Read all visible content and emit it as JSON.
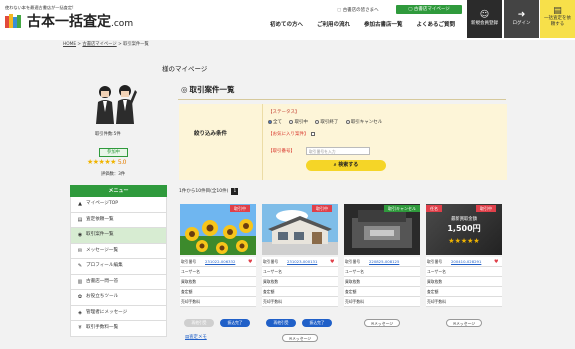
{
  "header": {
    "tagline": "使わない本を最適古書店が一括査定!",
    "logo_main": "古本一括査定",
    "logo_suffix": ".com",
    "greeting": "古書店の皆さまへ",
    "mypage_label": "古書店マイページ",
    "nav": [
      "初めての方へ",
      "ご利用の流れ",
      "参加古書店一覧",
      "よくあるご質問"
    ],
    "btn_register": "新規会員登録",
    "btn_login": "ログイン",
    "btn_bulk": "一括査定を依頼する"
  },
  "breadcrumb": {
    "home": "HOME",
    "sep": ">",
    "mypage": "古書店マイページ",
    "current": "取引案件一覧"
  },
  "page_title": "様のマイページ",
  "sidebar": {
    "deal_count": "取引件数:5件",
    "status": "参加中",
    "stars": "★★★★★",
    "rating": "5.0",
    "review_count": "評価数：3件",
    "menu_title": "メニュー",
    "menu": [
      {
        "label": "マイページTOP",
        "icon": "person-icon",
        "glyph": "▲"
      },
      {
        "label": "査定依頼一覧",
        "icon": "document-icon",
        "glyph": "▤"
      },
      {
        "label": "取引案件一覧",
        "icon": "handshake-icon",
        "glyph": "◉"
      },
      {
        "label": "メッセージ一覧",
        "icon": "mail-icon",
        "glyph": "✉"
      },
      {
        "label": "プロフィール編集",
        "icon": "pencil-icon",
        "glyph": "✎"
      },
      {
        "label": "古書店一問一答",
        "icon": "book-icon",
        "glyph": "▥"
      },
      {
        "label": "お役立ちツール",
        "icon": "tool-icon",
        "glyph": "✿"
      },
      {
        "label": "管理者にメッセージ",
        "icon": "chat-icon",
        "glyph": "◈"
      },
      {
        "label": "取引手数料一覧",
        "icon": "money-icon",
        "glyph": "¥"
      }
    ]
  },
  "main": {
    "title": "取引案件一覧",
    "filter": {
      "label": "絞り込み条件",
      "status_label": "【ステータス】",
      "status_options": [
        "全て",
        "取引中",
        "取引終了",
        "取引キャンセル"
      ],
      "status_selected": "全て",
      "fav_label": "【お気に入り案件】",
      "number_label": "【取引番号】",
      "number_placeholder": "取引番号を入力",
      "search_label": "検索する"
    },
    "count_text": "1件から10件目(全10件)",
    "page": "1"
  },
  "cards": [
    {
      "badge": "取引中",
      "number": "231022-006332",
      "favorite": true,
      "fields": [
        "取引番号",
        "ユーザー名",
        "買取枚数",
        "査定額",
        "売却手数料"
      ],
      "buttons": [
        "再他引受",
        "振込完了"
      ]
    },
    {
      "badge": "取引中",
      "number": "231023-000131",
      "favorite": true,
      "fields": [
        "取引番号",
        "ユーザー名",
        "買取枚数",
        "査定額",
        "売却手数料"
      ],
      "buttons": [
        "再他引受",
        "振込完了",
        "メッセージ"
      ]
    },
    {
      "badge": "取引キャンセル",
      "number": "220825-008125",
      "favorite": false,
      "fields": [
        "取引番号",
        "ユーザー名",
        "買取枚数",
        "査定額",
        "売却手数料"
      ],
      "buttons": [
        "メッセージ"
      ]
    },
    {
      "badge": "取引中",
      "number": "200410-028291",
      "favorite": true,
      "fields": [
        "取引番号",
        "ユーザー名",
        "買取枚数",
        "査定額",
        "売却手数料"
      ],
      "buttons": [
        "メッセージ"
      ],
      "overlay_title": "最新買取金額",
      "overlay_price": "1,500円",
      "overlay_tag": "任名"
    }
  ],
  "history_link": "査定メモ",
  "colors": {
    "green": "#2f9a3c",
    "yellow": "#f5d527",
    "blue": "#2060c8",
    "red": "#e0404a"
  }
}
